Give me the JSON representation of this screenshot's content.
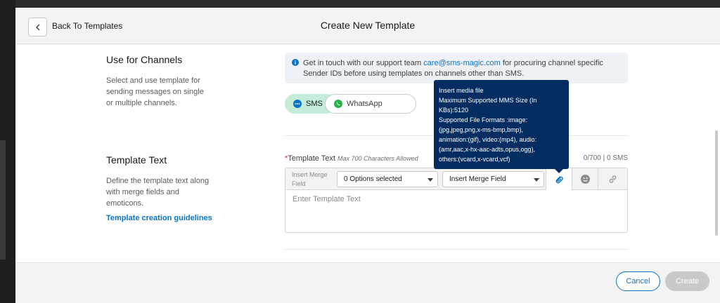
{
  "header": {
    "back_label": "Back To Templates",
    "title": "Create New Template"
  },
  "channels": {
    "title": "Use for Channels",
    "description": "Select and use template for sending messages on single or multiple channels.",
    "info_text_before": "Get in touch with our support team ",
    "info_email": "care@sms-magic.com",
    "info_text_after": " for procuring channel specific Sender IDs before using templates on channels other than SMS.",
    "options": [
      {
        "label": "SMS",
        "selected": true,
        "icon": "sms-bubble-icon"
      },
      {
        "label": "WhatsApp",
        "selected": false,
        "icon": "whatsapp-icon"
      }
    ]
  },
  "template_text": {
    "title": "Template Text",
    "description": "Define the template text along with merge fields and emoticons.",
    "guidelines_link": "Template creation guidelines",
    "field_label": "Template Text",
    "required_marker": "*",
    "hint": "Max 700 Characters Allowed",
    "counter": "0/700 | 0 SMS",
    "merge_label": "Insert Merge Field",
    "options_select": "0 Options selected",
    "merge_select": "Insert Merge Field",
    "placeholder": "Enter Template Text",
    "toolbar_icons": [
      "attachment-icon",
      "emoji-icon",
      "link-icon"
    ]
  },
  "tooltip": {
    "lines": [
      "Insert media file",
      "Maximum Supported MMS Size (In",
      "KBs):5120",
      "Supported File Formats :image:",
      "(jpg,jpeg,png,x-ms-bmp,bmp),",
      "animation:(gif), video:(mp4), audio:",
      "(amr,aac,x-hx-aac-adts,opus,ogg),",
      "others:(vcard,x-vcard,vcf)"
    ]
  },
  "footer": {
    "cancel_label": "Cancel",
    "create_label": "Create"
  },
  "colors": {
    "accent": "#0b74c4",
    "sms_selected_bg": "#c3ecd9",
    "tooltip_bg": "#032d60",
    "disabled_btn": "#c9c9c9"
  }
}
